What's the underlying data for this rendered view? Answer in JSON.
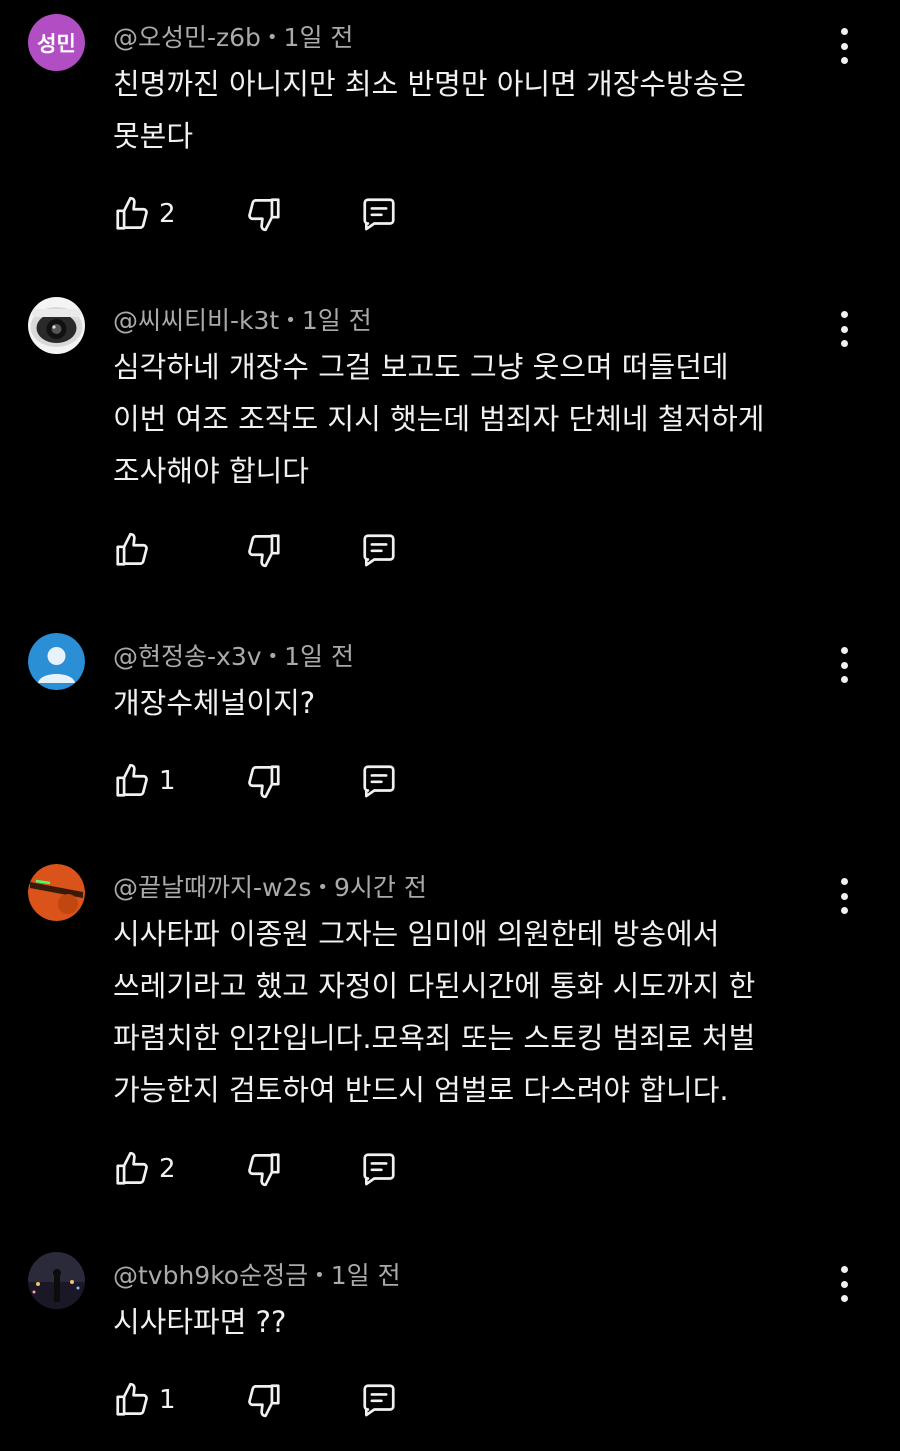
{
  "comments": [
    {
      "author": "@오성민-z6b",
      "time": "1일 전",
      "avatar_text": "성민",
      "avatar_type": "initials",
      "avatar_color": "#b14ec4",
      "lines": [
        "친명까진 아니지만 최소 반명만 아니면 개장수방송은",
        "못본다"
      ],
      "likes": "2"
    },
    {
      "author": "@씨씨티비-k3t",
      "time": "1일 전",
      "avatar_type": "cctv-camera",
      "lines": [
        "심각하네  개장수 그걸 보고도 그냥 웃으며 떠들던데",
        "이번 여조 조작도 지시 햇는데 범죄자 단체네 철저하게",
        "조사해야 합니다"
      ],
      "likes": ""
    },
    {
      "author": "@현정송-x3v",
      "time": "1일 전",
      "avatar_type": "default-person",
      "avatar_color": "#2b8fd6",
      "lines": [
        "개장수체널이지?"
      ],
      "likes": "1"
    },
    {
      "author": "@끝날때까지-w2s",
      "time": "9시간 전",
      "avatar_type": "orange-photo",
      "avatar_color": "#d9531a",
      "lines": [
        "시사타파 이종원 그자는 임미애 의원한테 방송에서",
        "쓰레기라고 했고 자정이 다된시간에 통화 시도까지 한",
        "파렴치한 인간입니다.모욕죄 또는 스토킹 범죄로 처벌",
        "가능한지 검토하여 반드시 엄벌로 다스려야 합니다."
      ],
      "likes": "2"
    },
    {
      "author": "@tvbh9ko순정금",
      "time": "1일 전",
      "avatar_type": "night-photo",
      "lines": [
        "시사타파면 ??"
      ],
      "likes": "1"
    }
  ]
}
